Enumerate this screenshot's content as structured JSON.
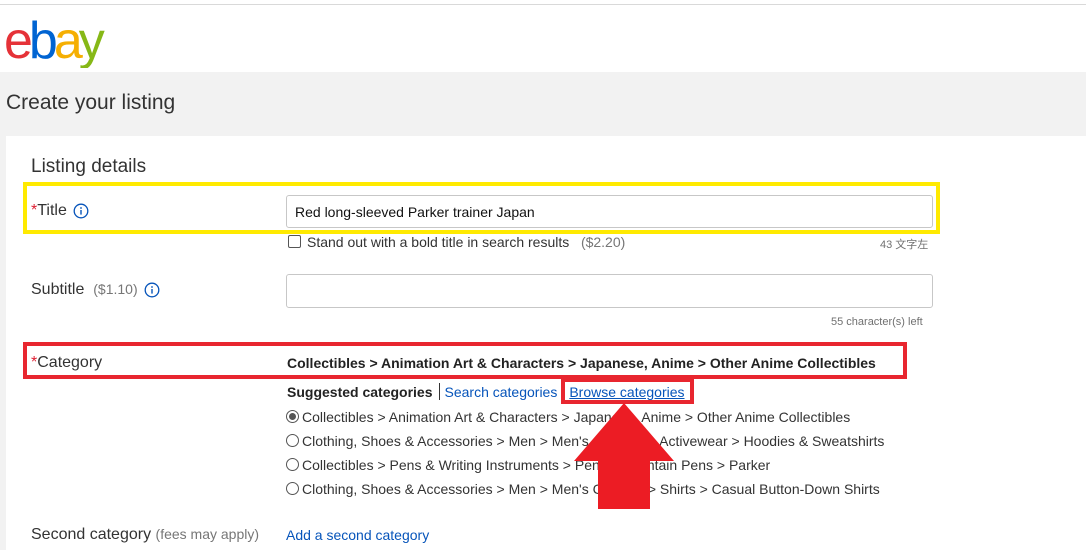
{
  "logo": {
    "text": "ebay",
    "colors": [
      "#e53238",
      "#0064d2",
      "#f5af02",
      "#86b817"
    ]
  },
  "page": {
    "title": "Create your listing"
  },
  "section": {
    "title": "Listing details"
  },
  "title_field": {
    "label": "Title",
    "required_mark": "*",
    "value": "Red long-sleeved Parker trainer Japan",
    "bold_option_label": "Stand out with a bold title in search results",
    "bold_option_fee": "($2.20)",
    "counter": "43 文字左"
  },
  "subtitle_field": {
    "label": "Subtitle",
    "fee": "($1.10)",
    "value": "",
    "counter": "55 character(s) left"
  },
  "category": {
    "label": "Category",
    "required_mark": "*",
    "selected_path": "Collectibles > Animation Art & Characters > Japanese, Anime > Other Anime Collectibles",
    "tabs": {
      "suggested": "Suggested categories",
      "search": "Search categories",
      "browse": "Browse categories"
    },
    "suggestions": [
      {
        "text": "Collectibles > Animation Art & Characters > Japanese, Anime > Other Anime Collectibles",
        "checked": true
      },
      {
        "text": "Clothing, Shoes & Accessories > Men > Men's Clothing > Activewear > Hoodies & Sweatshirts",
        "checked": false
      },
      {
        "text": "Collectibles > Pens & Writing Instruments > Pens > Fountain Pens > Parker",
        "checked": false
      },
      {
        "text": "Clothing, Shoes & Accessories > Men > Men's Clothing > Shirts > Casual Button-Down Shirts",
        "checked": false
      }
    ]
  },
  "second_category": {
    "label": "Second category",
    "fee_note": "(fees may apply)",
    "add_link": "Add a second category"
  },
  "annotations": {
    "title_highlight_color": "#ffea00",
    "category_highlight_color": "#e8262f",
    "arrow_color": "#e8262f"
  }
}
